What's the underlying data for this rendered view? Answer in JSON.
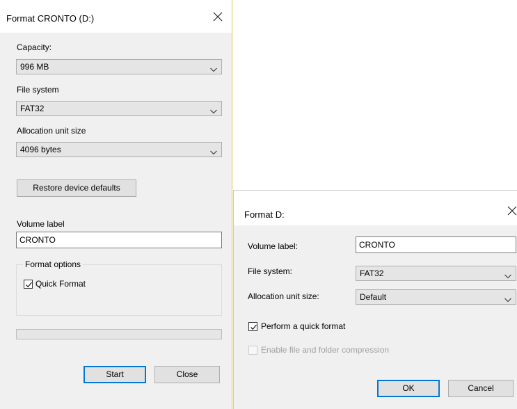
{
  "format_dialog": {
    "title": "Format CRONTO (D:)",
    "capacity_label": "Capacity:",
    "capacity_value": "996 MB",
    "file_system_label": "File system",
    "file_system_value": "FAT32",
    "allocation_label": "Allocation unit size",
    "allocation_value": "4096 bytes",
    "restore_button": "Restore device defaults",
    "volume_label_label": "Volume label",
    "volume_label_value": "CRONTO",
    "format_options_title": "Format options",
    "quick_format_label": "Quick Format",
    "quick_format_checked": true,
    "progress": 0,
    "start_button": "Start",
    "close_button": "Close"
  },
  "format_d_dialog": {
    "title": "Format D:",
    "volume_label_label": "Volume label:",
    "volume_label_value": "CRONTO",
    "file_system_label": "File system:",
    "file_system_value": "FAT32",
    "allocation_label": "Allocation unit size:",
    "allocation_value": "Default",
    "quick_format_label": "Perform a quick format",
    "quick_format_checked": true,
    "compression_label": "Enable file and folder compression",
    "compression_enabled": false,
    "ok_button": "OK",
    "cancel_button": "Cancel"
  },
  "icons": {
    "close": "close-icon",
    "chevron": "chevron-down-icon",
    "check": "checkmark-icon"
  },
  "colors": {
    "dialog_bg": "#f0f0f0",
    "titlebar_bg": "#ffffff",
    "accent": "#0078d7",
    "border": "#adadad"
  }
}
